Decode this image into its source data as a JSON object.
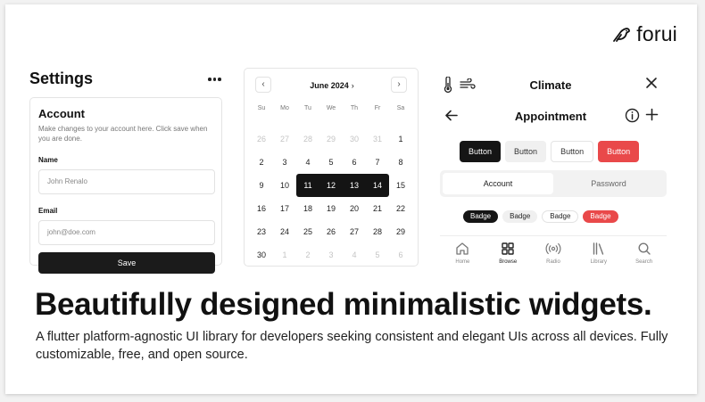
{
  "brand": {
    "name": "forui"
  },
  "settings": {
    "title": "Settings",
    "card": {
      "heading": "Account",
      "description": "Make changes to your account here. Click save when you are done.",
      "name_label": "Name",
      "name_value": "John Renalo",
      "email_label": "Email",
      "email_value": "john@doe.com",
      "save_label": "Save"
    }
  },
  "calendar": {
    "month_label": "June 2024",
    "weekdays": [
      "Su",
      "Mo",
      "Tu",
      "We",
      "Th",
      "Fr",
      "Sa"
    ],
    "days": [
      {
        "d": "26",
        "muted": true
      },
      {
        "d": "27",
        "muted": true
      },
      {
        "d": "28",
        "muted": true
      },
      {
        "d": "29",
        "muted": true
      },
      {
        "d": "30",
        "muted": true
      },
      {
        "d": "31",
        "muted": true
      },
      {
        "d": "1"
      },
      {
        "d": "2"
      },
      {
        "d": "3"
      },
      {
        "d": "4"
      },
      {
        "d": "5"
      },
      {
        "d": "6"
      },
      {
        "d": "7"
      },
      {
        "d": "8"
      },
      {
        "d": "9"
      },
      {
        "d": "10"
      },
      {
        "d": "11",
        "selected": true
      },
      {
        "d": "12",
        "selected": true
      },
      {
        "d": "13",
        "selected": true
      },
      {
        "d": "14",
        "selected": true
      },
      {
        "d": "15"
      },
      {
        "d": "16"
      },
      {
        "d": "17"
      },
      {
        "d": "18"
      },
      {
        "d": "19"
      },
      {
        "d": "20"
      },
      {
        "d": "21"
      },
      {
        "d": "22"
      },
      {
        "d": "23"
      },
      {
        "d": "24"
      },
      {
        "d": "25"
      },
      {
        "d": "26"
      },
      {
        "d": "27"
      },
      {
        "d": "28"
      },
      {
        "d": "29"
      },
      {
        "d": "30"
      },
      {
        "d": "1",
        "muted": true
      },
      {
        "d": "2",
        "muted": true
      },
      {
        "d": "3",
        "muted": true
      },
      {
        "d": "4",
        "muted": true
      },
      {
        "d": "5",
        "muted": true
      },
      {
        "d": "6",
        "muted": true
      }
    ]
  },
  "climate_header": {
    "title": "Climate",
    "icons": [
      "thermometer-icon",
      "wind-icon",
      "close-icon"
    ]
  },
  "appointment_header": {
    "title": "Appointment",
    "icons": [
      "back-arrow-icon",
      "info-icon",
      "plus-icon"
    ]
  },
  "buttons": [
    {
      "label": "Button",
      "variant": "primary"
    },
    {
      "label": "Button",
      "variant": "secondary"
    },
    {
      "label": "Button",
      "variant": "outline"
    },
    {
      "label": "Button",
      "variant": "destructive"
    }
  ],
  "tabs": [
    {
      "label": "Account",
      "active": true
    },
    {
      "label": "Password",
      "active": false
    }
  ],
  "badges": [
    {
      "label": "Badge",
      "variant": "primary"
    },
    {
      "label": "Badge",
      "variant": "secondary"
    },
    {
      "label": "Badge",
      "variant": "outline"
    },
    {
      "label": "Badge",
      "variant": "destructive"
    }
  ],
  "bottom_nav": [
    {
      "label": "Home",
      "icon": "home-icon",
      "active": false
    },
    {
      "label": "Browse",
      "icon": "grid-icon",
      "active": true
    },
    {
      "label": "Radio",
      "icon": "radio-icon",
      "active": false
    },
    {
      "label": "Library",
      "icon": "library-icon",
      "active": false
    },
    {
      "label": "Search",
      "icon": "search-icon",
      "active": false
    }
  ],
  "hero": {
    "headline": "Beautifully designed minimalistic widgets.",
    "subline": "A flutter platform-agnostic UI library for developers seeking consistent and elegant UIs across all devices. Fully customizable, free, and open source."
  },
  "colors": {
    "primary": "#151515",
    "destructive": "#e9494a",
    "border": "#e4e4e4",
    "muted": "#f0f0f0"
  }
}
